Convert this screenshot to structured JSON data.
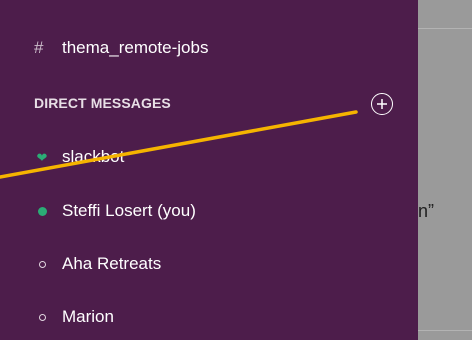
{
  "sidebar": {
    "channel": {
      "label": "thema_remote-jobs",
      "icon": "hash-icon"
    },
    "direct_messages": {
      "header": "DIRECT MESSAGES",
      "add_icon": "plus-circle-icon",
      "items": [
        {
          "label": "slackbot",
          "presence": "heart"
        },
        {
          "label": "Steffi Losert (you)",
          "presence": "online"
        },
        {
          "label": "Aha Retreats",
          "presence": "offline"
        },
        {
          "label": "Marion",
          "presence": "offline"
        }
      ]
    }
  },
  "main": {
    "snippet": "n”"
  },
  "colors": {
    "sidebar_bg": "#4d1d4b",
    "presence_online": "#2bac76",
    "annotation_arrow": "#f5b400"
  }
}
